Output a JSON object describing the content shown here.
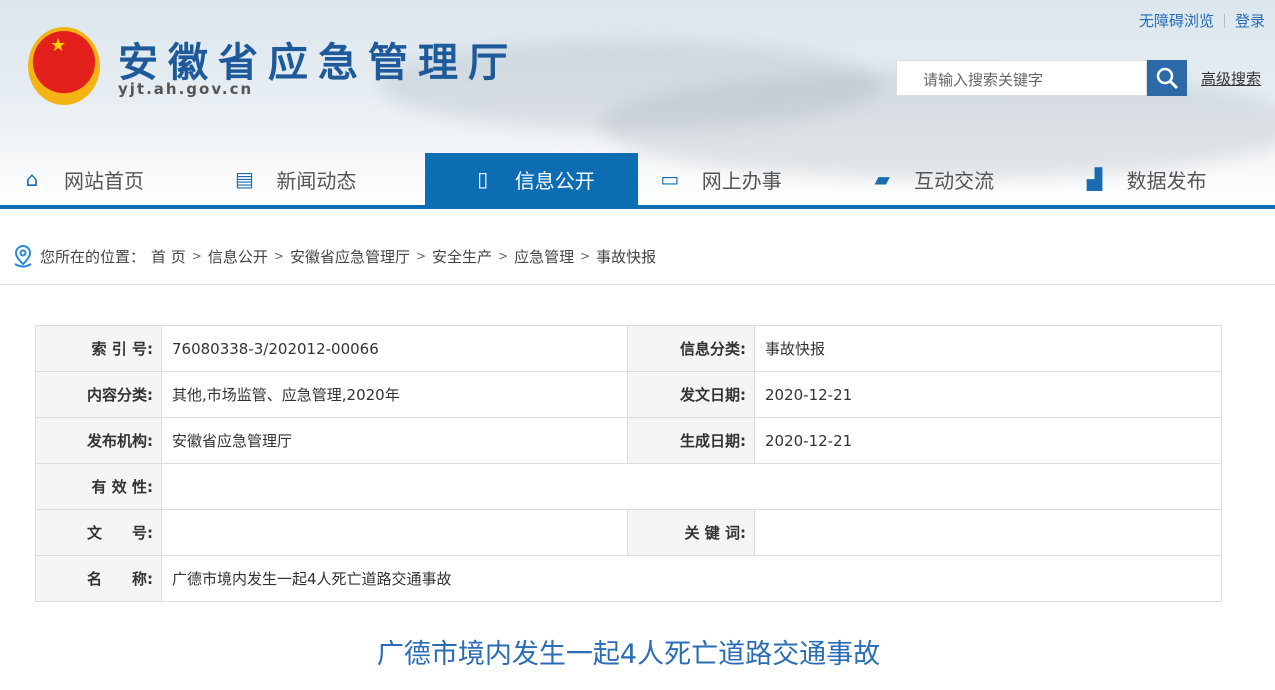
{
  "header": {
    "title": "安徽省应急管理厅",
    "url": "yjt.ah.gov.cn",
    "accessibility": "无障碍浏览",
    "login": "登录",
    "search_placeholder": "请输入搜索关键字",
    "advanced_search": "高级搜索"
  },
  "nav": [
    {
      "label": "网站首页",
      "icon": "home-icon"
    },
    {
      "label": "新闻动态",
      "icon": "news-icon"
    },
    {
      "label": "信息公开",
      "icon": "document-icon",
      "active": true
    },
    {
      "label": "网上办事",
      "icon": "monitor-icon"
    },
    {
      "label": "互动交流",
      "icon": "chat-icon"
    },
    {
      "label": "数据发布",
      "icon": "chart-icon"
    }
  ],
  "breadcrumb": {
    "prefix": "您所在的位置：",
    "items": [
      "首 页",
      "信息公开",
      "安徽省应急管理厅",
      "安全生产",
      "应急管理",
      "事故快报"
    ]
  },
  "meta": {
    "index_label": "索 引 号:",
    "index": "76080338-3/202012-00066",
    "category_label": "信息分类:",
    "category": "事故快报",
    "content_label": "内容分类:",
    "content": "其他,市场监管、应急管理,2020年",
    "issue_date_label": "发文日期:",
    "issue_date": "2020-12-21",
    "org_label": "发布机构:",
    "org": "安徽省应急管理厅",
    "gen_date_label": "生成日期:",
    "gen_date": "2020-12-21",
    "validity_label": "有 效 性:",
    "validity": "",
    "doc_no_label": "文　　号:",
    "doc_no": "",
    "keywords_label": "关 键 词:",
    "keywords": "",
    "name_label": "名　　称:",
    "name": "广德市境内发生一起4人死亡道路交通事故"
  },
  "article": {
    "title": "广德市境内发生一起4人死亡道路交通事故"
  }
}
